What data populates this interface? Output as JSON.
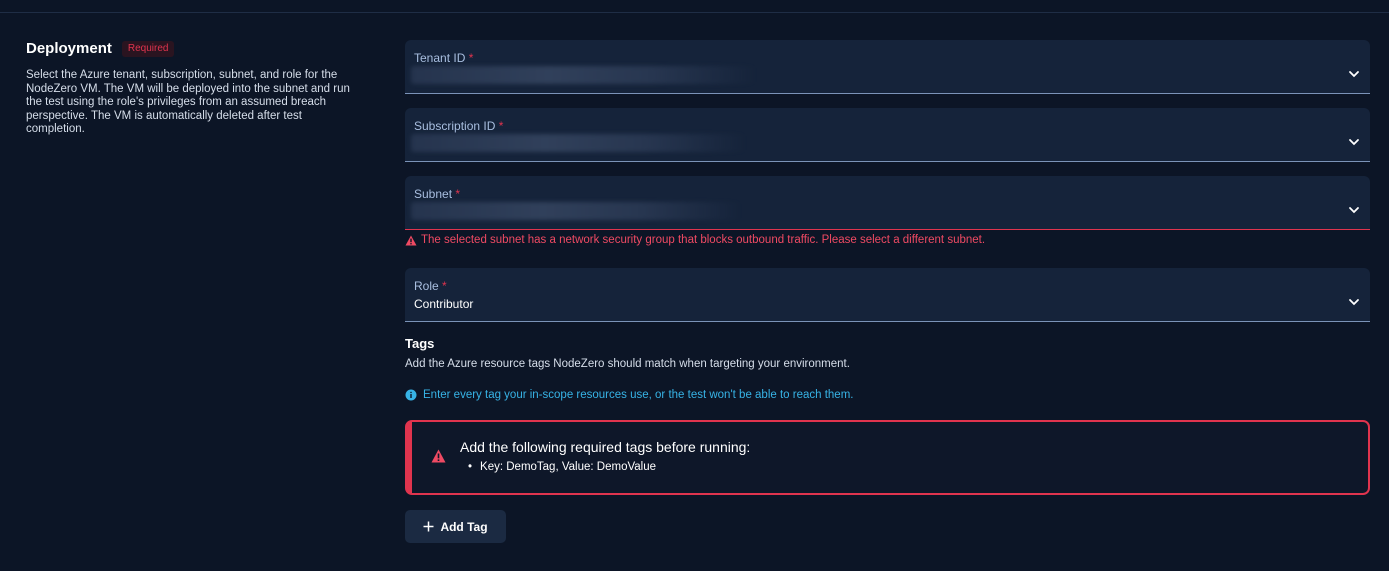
{
  "deployment": {
    "title": "Deployment",
    "required_badge": "Required",
    "description": "Select the Azure tenant, subscription, subnet, and role for the NodeZero VM. The VM will be deployed into the subnet and run the test using the role's privileges from an assumed breach perspective. The VM is automatically deleted after test completion."
  },
  "fields": {
    "tenant": {
      "label": "Tenant ID",
      "required_mark": "*"
    },
    "subscription": {
      "label": "Subscription ID",
      "required_mark": "*"
    },
    "subnet": {
      "label": "Subnet",
      "required_mark": "*",
      "error": "The selected subnet has a network security group that blocks outbound traffic. Please select a different subnet."
    },
    "role": {
      "label": "Role",
      "required_mark": "*",
      "value": "Contributor"
    }
  },
  "tags": {
    "title": "Tags",
    "description": "Add the Azure resource tags NodeZero should match when targeting your environment.",
    "info": "Enter every tag your in-scope resources use, or the test won't be able to reach them.",
    "alert_title": "Add the following required tags before running:",
    "required_tags": [
      "Key: DemoTag, Value: DemoValue"
    ],
    "add_button": "Add Tag"
  },
  "icons": {
    "chevron": "chevron-down-icon",
    "warning": "warning-triangle-icon",
    "info": "info-circle-icon",
    "plus": "plus-icon"
  },
  "colors": {
    "background": "#0c1526",
    "field_bg": "#15233a",
    "error": "#e0344e",
    "info": "#37b3e6"
  }
}
